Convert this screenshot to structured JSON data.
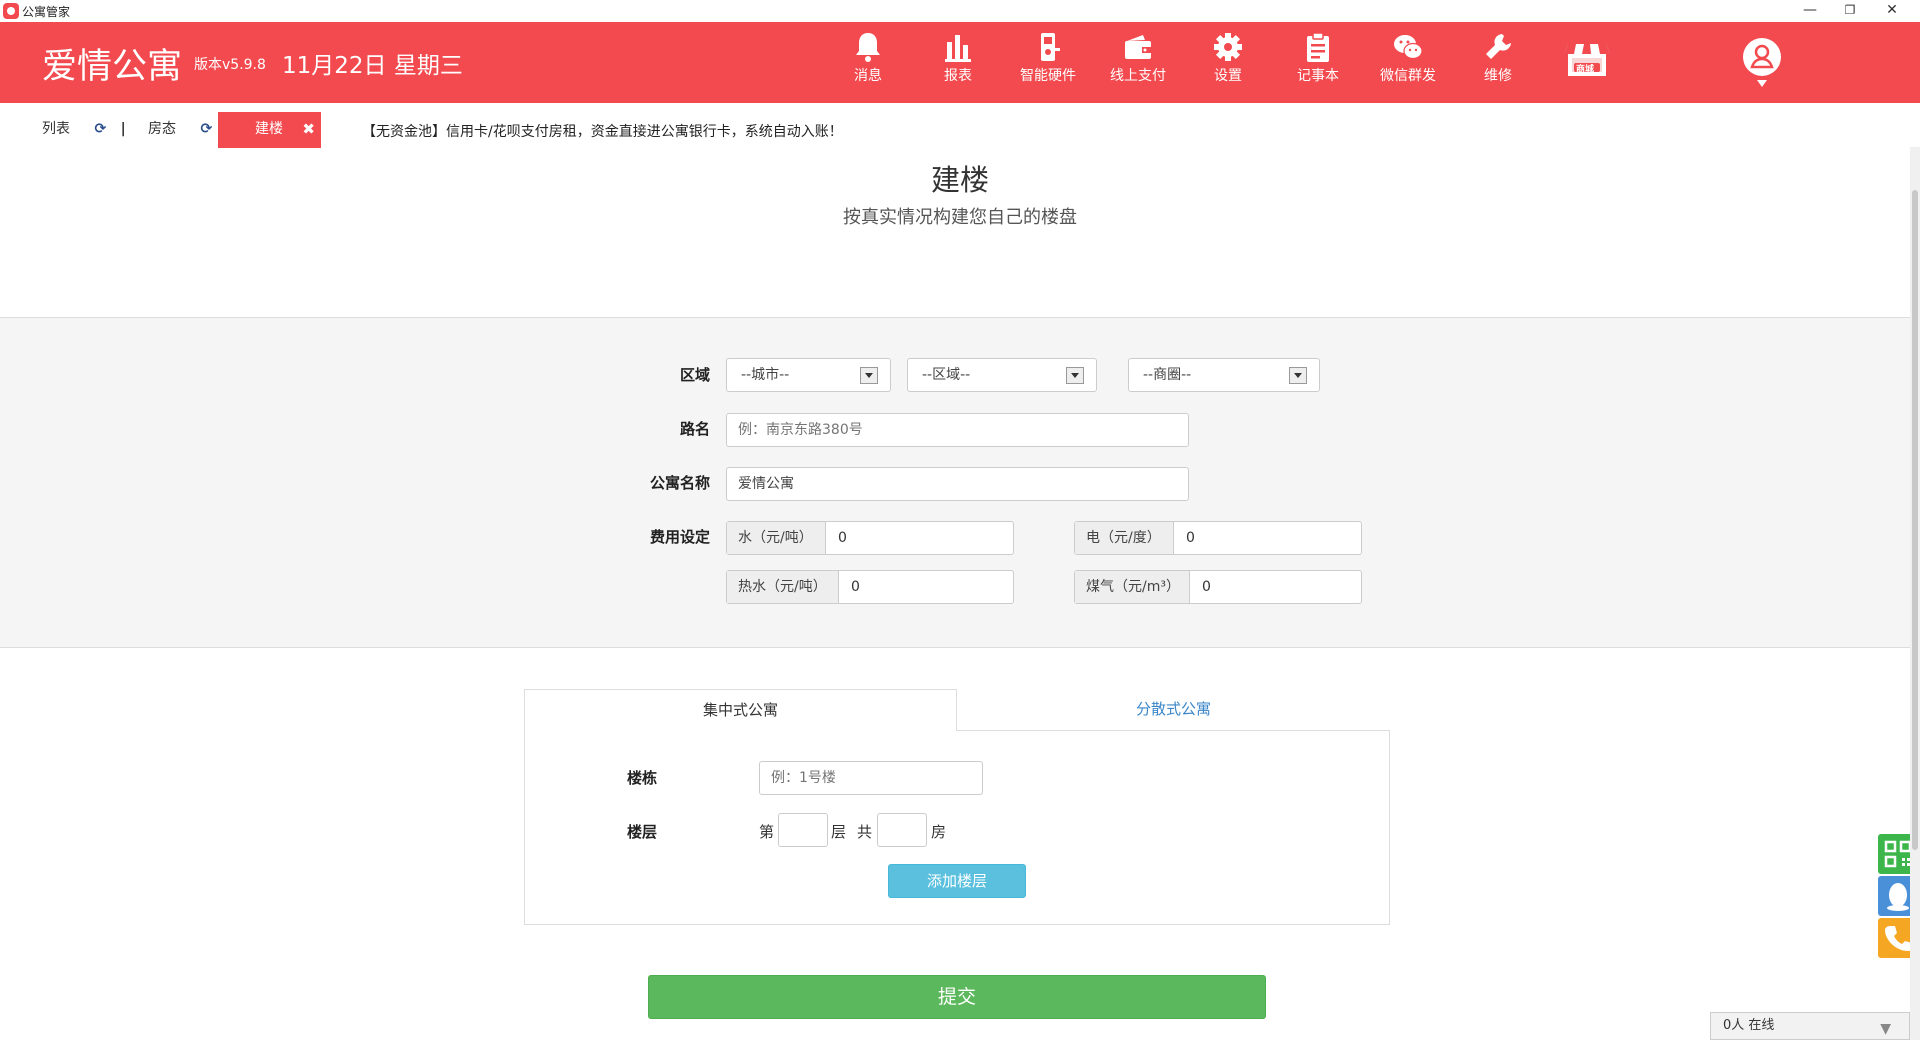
{
  "window": {
    "title": "公寓管家",
    "minimize": "—",
    "restore": "❐",
    "close": "✕"
  },
  "header": {
    "logo": "爱情公寓",
    "version": "版本v5.9.8",
    "date": "11月22日 星期三",
    "nav": [
      {
        "label": "消息",
        "icon": "bell-icon"
      },
      {
        "label": "报表",
        "icon": "bar-chart-icon"
      },
      {
        "label": "智能硬件",
        "icon": "smart-lock-icon"
      },
      {
        "label": "线上支付",
        "icon": "wallet-icon"
      },
      {
        "label": "设置",
        "icon": "gear-icon"
      },
      {
        "label": "记事本",
        "icon": "clipboard-icon"
      },
      {
        "label": "微信群发",
        "icon": "wechat-icon"
      },
      {
        "label": "维修",
        "icon": "wrench-icon"
      }
    ],
    "shop_label": "商城",
    "colors": {
      "brand": "#f24a4e"
    }
  },
  "tabs": {
    "items": [
      {
        "label": "列表",
        "refresh": "⟳"
      },
      {
        "label": "房态",
        "refresh": "⟳"
      },
      {
        "label": "建楼",
        "close": "✖"
      }
    ],
    "separator": "|",
    "notice": "【无资金池】信用卡/花呗支付房租，资金直接进公寓银行卡，系统自动入账！"
  },
  "page": {
    "title": "建楼",
    "subtitle": "按真实情况构建您自己的楼盘"
  },
  "form": {
    "region_label": "区域",
    "city": "--城市--",
    "district": "--区域--",
    "business": "--商圈--",
    "road_label": "路名",
    "road_placeholder": "例：南京东路380号",
    "name_label": "公寓名称",
    "name_value": "爱情公寓",
    "fee_label": "费用设定",
    "fees": [
      {
        "label": "水（元/吨）",
        "value": "0"
      },
      {
        "label": "电（元/度）",
        "value": "0"
      },
      {
        "label": "热水（元/吨）",
        "value": "0"
      },
      {
        "label": "煤气（元/m³）",
        "value": "0"
      }
    ]
  },
  "building": {
    "tab_central": "集中式公寓",
    "tab_scattered": "分散式公寓",
    "building_label": "楼栋",
    "building_placeholder": "例：1号楼",
    "floor_label": "楼层",
    "floor_prefix": "第",
    "floor_suffix": "层",
    "total_prefix": "共",
    "room_suffix": "房",
    "add_floor": "添加楼层"
  },
  "submit_label": "提交",
  "online": "0人 在线",
  "online_toggle": "▼"
}
